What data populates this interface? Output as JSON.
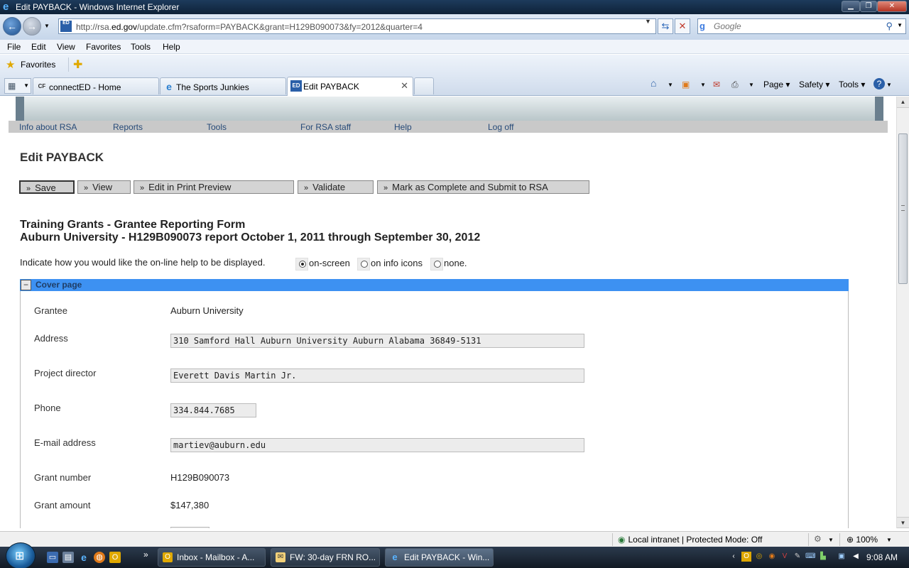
{
  "window": {
    "title": "Edit PAYBACK - Windows Internet Explorer",
    "controls": [
      "▁",
      "❐",
      "✕"
    ]
  },
  "address_bar": {
    "url_prefix": "http://rsa.",
    "url_domain": "ed.gov",
    "url_path": "/update.cfm?rsaform=PAYBACK&grant=H129B090073&fy=2012&quarter=4",
    "search_placeholder": "Google",
    "site_icon_text": "ED"
  },
  "menubar": [
    "File",
    "Edit",
    "View",
    "Favorites",
    "Tools",
    "Help"
  ],
  "favorites_label": "Favorites",
  "tabs": [
    {
      "label": "connectED - Home",
      "icon": "cf-icon"
    },
    {
      "label": "The Sports Junkies",
      "icon": "ie-icon"
    },
    {
      "label": "Edit PAYBACK",
      "icon": "ed-icon"
    }
  ],
  "command_bar": {
    "page": "Page ▾",
    "safety": "Safety ▾",
    "tools": "Tools ▾"
  },
  "site_nav": [
    "Info about RSA",
    "Reports",
    "Tools",
    "For RSA staff",
    "Help",
    "Log off"
  ],
  "page": {
    "title": "Edit PAYBACK",
    "actions": [
      "Save",
      "View",
      "Edit in Print Preview",
      "Validate",
      "Mark as Complete and Submit to RSA"
    ],
    "form_title_line1": "Training Grants - Grantee Reporting Form",
    "form_title_line2": "Auburn University - H129B090073 report October 1, 2011 through September 30, 2012",
    "help_prompt": "Indicate how you would like the on-line help to be displayed.",
    "help_options": [
      {
        "label": "on-screen",
        "selected": true
      },
      {
        "label": "on info icons",
        "selected": false
      },
      {
        "label": "none.",
        "selected": false
      }
    ]
  },
  "cover_page": {
    "title": "Cover page",
    "collapse_symbol": "−",
    "fields": {
      "grantee_label": "Grantee",
      "grantee_value": "Auburn University",
      "address_label": "Address",
      "address_value": "310 Samford Hall Auburn University Auburn Alabama 36849-5131",
      "director_label": "Project director",
      "director_value": "Everett Davis Martin Jr.",
      "phone_label": "Phone",
      "phone_value": "334.844.7685",
      "email_label": "E-mail address",
      "email_value": "martiev@auburn.edu",
      "grant_number_label": "Grant number",
      "grant_number_value": "H129B090073",
      "grant_amount_label": "Grant amount",
      "grant_amount_value": "$147,380"
    }
  },
  "status_bar": {
    "zone": "Local intranet | Protected Mode: Off",
    "zoom": "100%"
  },
  "taskbar": {
    "buttons": [
      {
        "label": "Inbox - Mailbox - A...",
        "icon": "outlook-icon"
      },
      {
        "label": "FW: 30-day FRN RO...",
        "icon": "mail-icon"
      },
      {
        "label": "Edit PAYBACK - Win...",
        "icon": "ie-icon"
      }
    ],
    "clock": "9:08 AM"
  },
  "colors": {
    "section_header": "#3d91f2",
    "nav_link": "#274a78"
  }
}
